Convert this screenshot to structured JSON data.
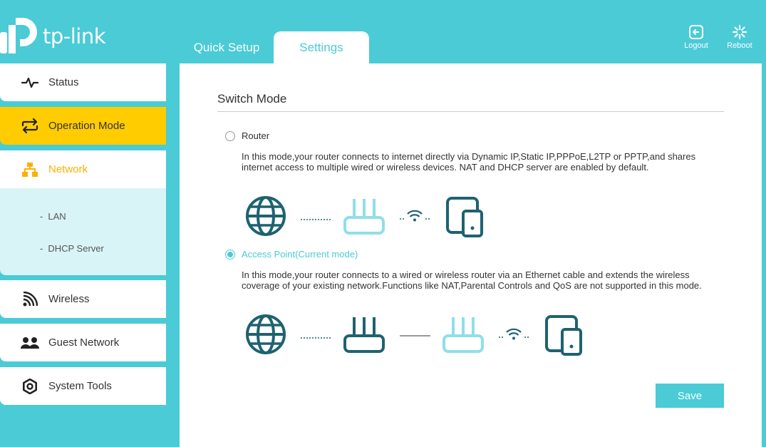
{
  "brand": {
    "logo_text": "tp-link"
  },
  "tabs": [
    {
      "label": "Quick Setup"
    },
    {
      "label": "Settings"
    }
  ],
  "top_actions": {
    "logout": "Logout",
    "reboot": "Reboot"
  },
  "sidebar": {
    "items": [
      {
        "label": "Status",
        "icon": "pulse-icon"
      },
      {
        "label": "Operation Mode",
        "icon": "switch-arrows-icon"
      },
      {
        "label": "Network",
        "icon": "network-icon"
      },
      {
        "label": "Wireless",
        "icon": "wireless-icon"
      },
      {
        "label": "Guest Network",
        "icon": "guest-icon"
      },
      {
        "label": "System Tools",
        "icon": "gear-icon"
      }
    ],
    "network_sub": [
      {
        "label": "LAN"
      },
      {
        "label": "DHCP Server"
      }
    ]
  },
  "main": {
    "title": "Switch Mode",
    "modes": [
      {
        "label": "Router",
        "selected": false,
        "description": "In this mode,your router connects to internet directly via Dynamic IP,Static IP,PPPoE,L2TP or PPTP,and shares internet access to multiple wired or wireless devices. NAT and DHCP server are enabled by default."
      },
      {
        "label": "Access Point(Current mode)",
        "selected": true,
        "description": "In this mode,your router connects to a wired or wireless router via an Ethernet cable and extends the wireless coverage of your existing network.Functions like NAT,Parental Controls and QoS are not supported in this mode."
      }
    ],
    "save_label": "Save"
  },
  "colors": {
    "accent": "#4acbd6",
    "active_menu": "#ffcc00",
    "open_menu_text": "#ffaf00",
    "icon_dark": "#1e6270",
    "icon_light": "#8fdfe8"
  }
}
